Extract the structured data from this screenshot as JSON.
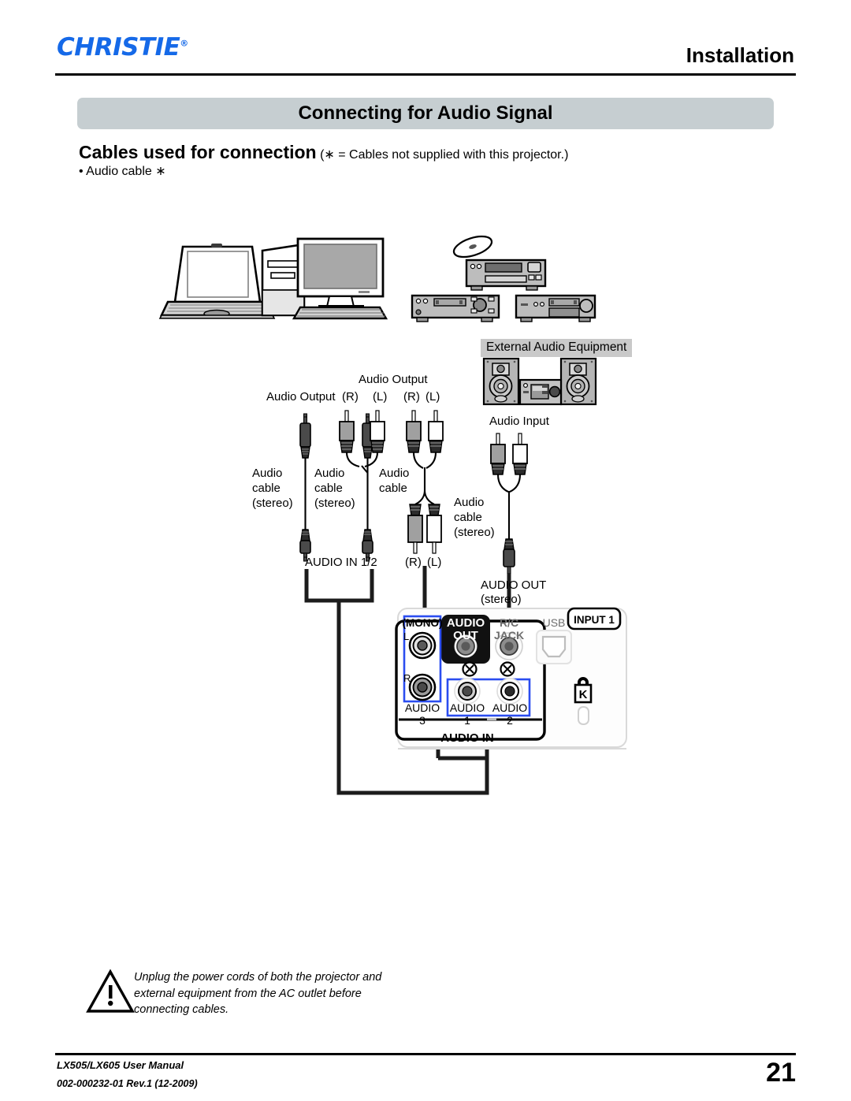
{
  "header": {
    "logo_text": "CHRISTIE",
    "logo_registered": "®",
    "logo_color": "#1569e8",
    "section": "Installation"
  },
  "title_bar": {
    "text": "Connecting for Audio Signal",
    "background": "#c6ced1"
  },
  "cables": {
    "heading_strong": "Cables used for connection",
    "heading_note": "(∗ = Cables not supplied with this projector.)",
    "items": [
      "• Audio cable ∗"
    ]
  },
  "diagram": {
    "equipment": {
      "laptop": "laptop-computer",
      "desktop": "desktop-computer",
      "disc": "optical-disc",
      "dvd_player": "dvd-player",
      "video_deck": "video-equipment",
      "av_receiver": "av-equipment",
      "speakers": "speaker-pair",
      "amplifier": "audio-amplifier"
    },
    "labels": {
      "external_audio_equipment": "External Audio Equipment",
      "audio_output_left": "Audio Output",
      "audio_output_top": "Audio Output",
      "audio_input": "Audio Input",
      "rca_r_1": "(R)",
      "rca_l_1": "(L)",
      "rca_r_2": "(R)",
      "rca_l_2": "(L)",
      "audio_cable_1": "Audio\ncable\n(stereo)",
      "audio_cable_2": "Audio\ncable\n(stereo)",
      "audio_cable_3": "Audio\ncable",
      "audio_cable_4": "Audio\ncable\n(stereo)",
      "audio_in_12": "AUDIO IN 1/2",
      "terminal_rca_r": "(R)",
      "terminal_rca_l": "(L)",
      "audio_out_stereo_line1": "AUDIO OUT",
      "audio_out_stereo_line2": "(stereo)"
    },
    "terminal_panel": {
      "mono": "(MONO)",
      "ch_l": "L",
      "ch_r": "R",
      "audio3_label": "AUDIO",
      "audio3_num": "3",
      "audio_out_line1": "AUDIO",
      "audio_out_line2": "OUT",
      "rc_jack_line1": "R/C",
      "rc_jack_line2": "JACK",
      "usb": "USB",
      "input1": "INPUT 1",
      "audio1_label": "AUDIO",
      "audio1_num": "1",
      "audio2_label": "AUDIO",
      "audio2_num": "2",
      "audio_in_bar": "AUDIO IN",
      "kensington": "K",
      "highlight_color": "#2b4df0"
    }
  },
  "warning": {
    "icon": "warning-triangle-icon",
    "text": "Unplug the power cords of both the projector and external equipment from the AC outlet before connecting cables."
  },
  "footer": {
    "manual": "LX505/LX605 User Manual",
    "doc_id": "002-000232-01 Rev.1 (12-2009)",
    "page_number": "21"
  }
}
